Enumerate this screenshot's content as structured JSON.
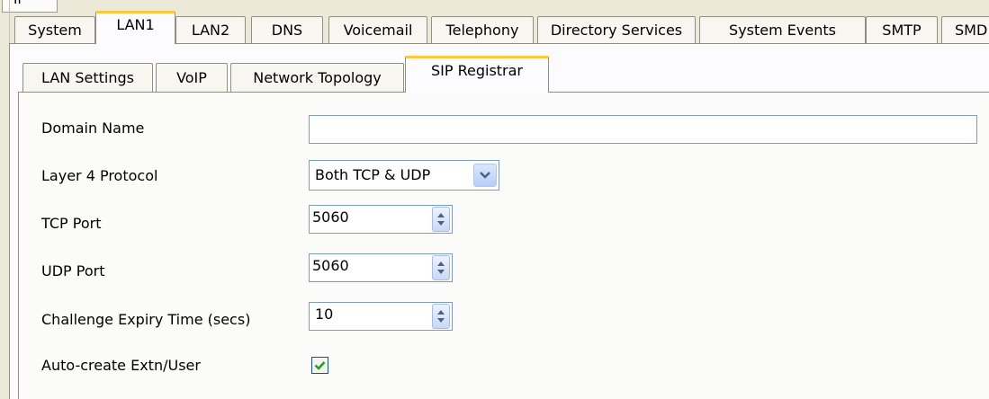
{
  "top_stub_label": "IP",
  "main_tabs": [
    {
      "label": "System"
    },
    {
      "label": "LAN1"
    },
    {
      "label": "LAN2"
    },
    {
      "label": "DNS"
    },
    {
      "label": "Voicemail"
    },
    {
      "label": "Telephony"
    },
    {
      "label": "Directory Services"
    },
    {
      "label": "System Events"
    },
    {
      "label": "SMTP"
    },
    {
      "label": "SMD"
    }
  ],
  "sub_tabs": [
    {
      "label": "LAN Settings"
    },
    {
      "label": "VoIP"
    },
    {
      "label": "Network Topology"
    },
    {
      "label": "SIP Registrar"
    }
  ],
  "form": {
    "domain_name": {
      "label": "Domain Name",
      "value": ""
    },
    "layer4_protocol": {
      "label": "Layer 4 Protocol",
      "value": "Both TCP & UDP"
    },
    "tcp_port": {
      "label": "TCP Port",
      "value": "5060"
    },
    "udp_port": {
      "label": "UDP Port",
      "value": "5060"
    },
    "challenge_expiry": {
      "label": "Challenge Expiry Time (secs)",
      "value": "10"
    },
    "auto_create": {
      "label": "Auto-create Extn/User",
      "checked": true
    }
  },
  "colors": {
    "selected_tab_accent": "#ffc83c",
    "check_mark": "#21a121",
    "field_border": "#7f9db9"
  }
}
